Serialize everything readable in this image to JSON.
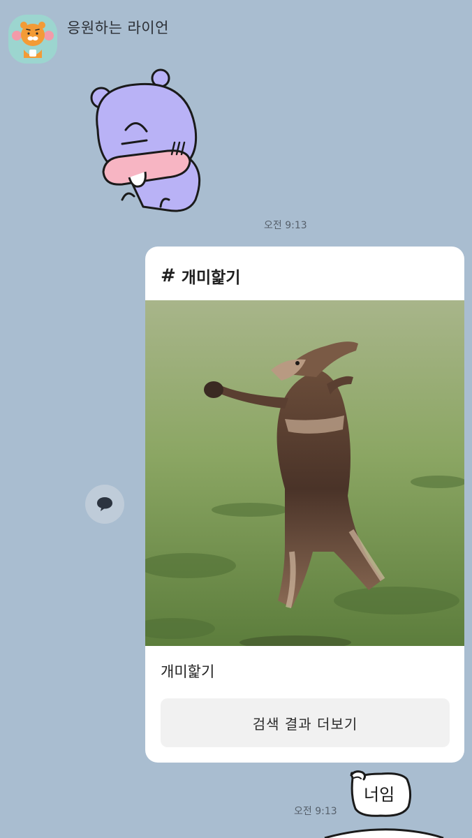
{
  "chat": {
    "sender_name": "응원하는 라이언",
    "messages": [
      {
        "type": "sticker",
        "time": "오전 9:13"
      },
      {
        "type": "search_card",
        "tag_symbol": "#",
        "tag": "개미핥기",
        "caption": "개미핥기",
        "button_label": "검색 결과 더보기"
      },
      {
        "type": "sticker",
        "text": "너임",
        "time": "오전 9:13"
      }
    ]
  },
  "icons": {
    "avatar": "lion-cheering-avatar-icon",
    "share": "speech-bubble-icon"
  },
  "colors": {
    "background": "#a9bdd0",
    "card": "#ffffff",
    "button": "#f1f1f1",
    "avatar_bg": "#9cd5cf"
  }
}
